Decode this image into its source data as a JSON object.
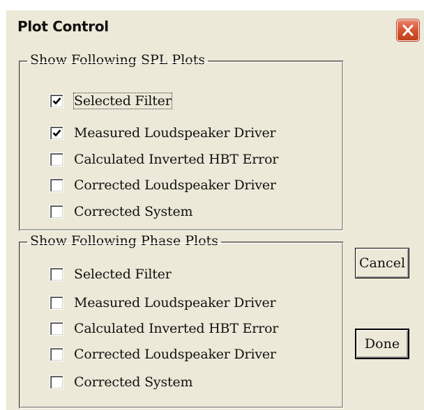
{
  "window": {
    "title": "Plot Control",
    "close_icon": "close-icon"
  },
  "spl_group": {
    "legend": "Show Following SPL Plots",
    "options": [
      {
        "label": "Selected Filter",
        "checked": true
      },
      {
        "label": "Measured Loudspeaker Driver",
        "checked": true
      },
      {
        "label": "Calculated Inverted HBT Error",
        "checked": false
      },
      {
        "label": "Corrected Loudspeaker Driver",
        "checked": false
      },
      {
        "label": "Corrected System",
        "checked": false
      }
    ]
  },
  "phase_group": {
    "legend": "Show Following Phase Plots",
    "options": [
      {
        "label": "Selected Filter",
        "checked": false
      },
      {
        "label": "Measured Loudspeaker Driver",
        "checked": false
      },
      {
        "label": "Calculated Inverted HBT Error",
        "checked": false
      },
      {
        "label": "Corrected Loudspeaker Driver",
        "checked": false
      },
      {
        "label": "Corrected System",
        "checked": false
      }
    ]
  },
  "buttons": {
    "cancel_label": "Cancel",
    "done_label": "Done"
  },
  "colors": {
    "dialog_bg": "#ECE9D8",
    "close_button": "#D4532C"
  }
}
